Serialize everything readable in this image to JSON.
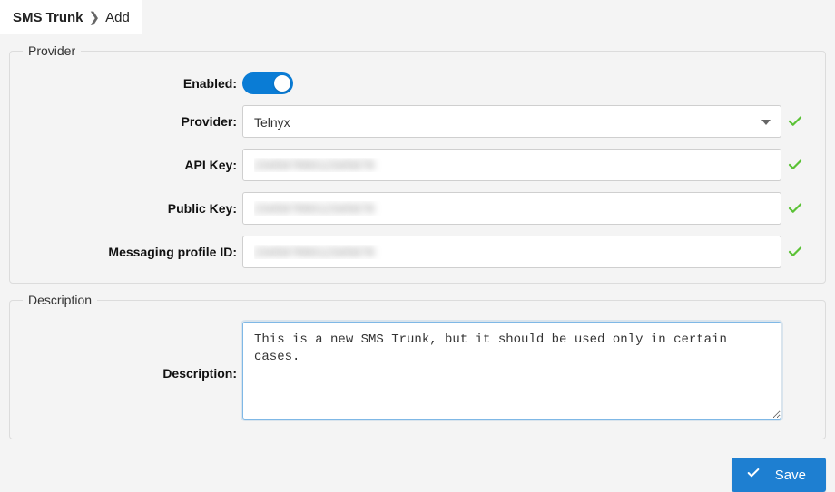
{
  "breadcrumb": {
    "root": "SMS Trunk",
    "separator": "❯",
    "current": "Add"
  },
  "colors": {
    "accent": "#1e7fd1",
    "success": "#5bc236"
  },
  "groups": {
    "provider": {
      "legend": "Provider",
      "fields": {
        "enabled": {
          "label": "Enabled:",
          "value": true
        },
        "provider": {
          "label": "Provider:",
          "selected": "Telnyx"
        },
        "api_key": {
          "label": "API Key:",
          "value": "23456789012345678",
          "valid": true
        },
        "public_key": {
          "label": "Public Key:",
          "value": "23456789012345678",
          "valid": true
        },
        "messaging_profile_id": {
          "label": "Messaging profile ID:",
          "value": "23456789012345678",
          "valid": true
        }
      }
    },
    "description": {
      "legend": "Description",
      "label": "Description:",
      "value": "This is a new SMS Trunk, but it should be used only in certain cases."
    }
  },
  "footer": {
    "save_label": "Save"
  }
}
